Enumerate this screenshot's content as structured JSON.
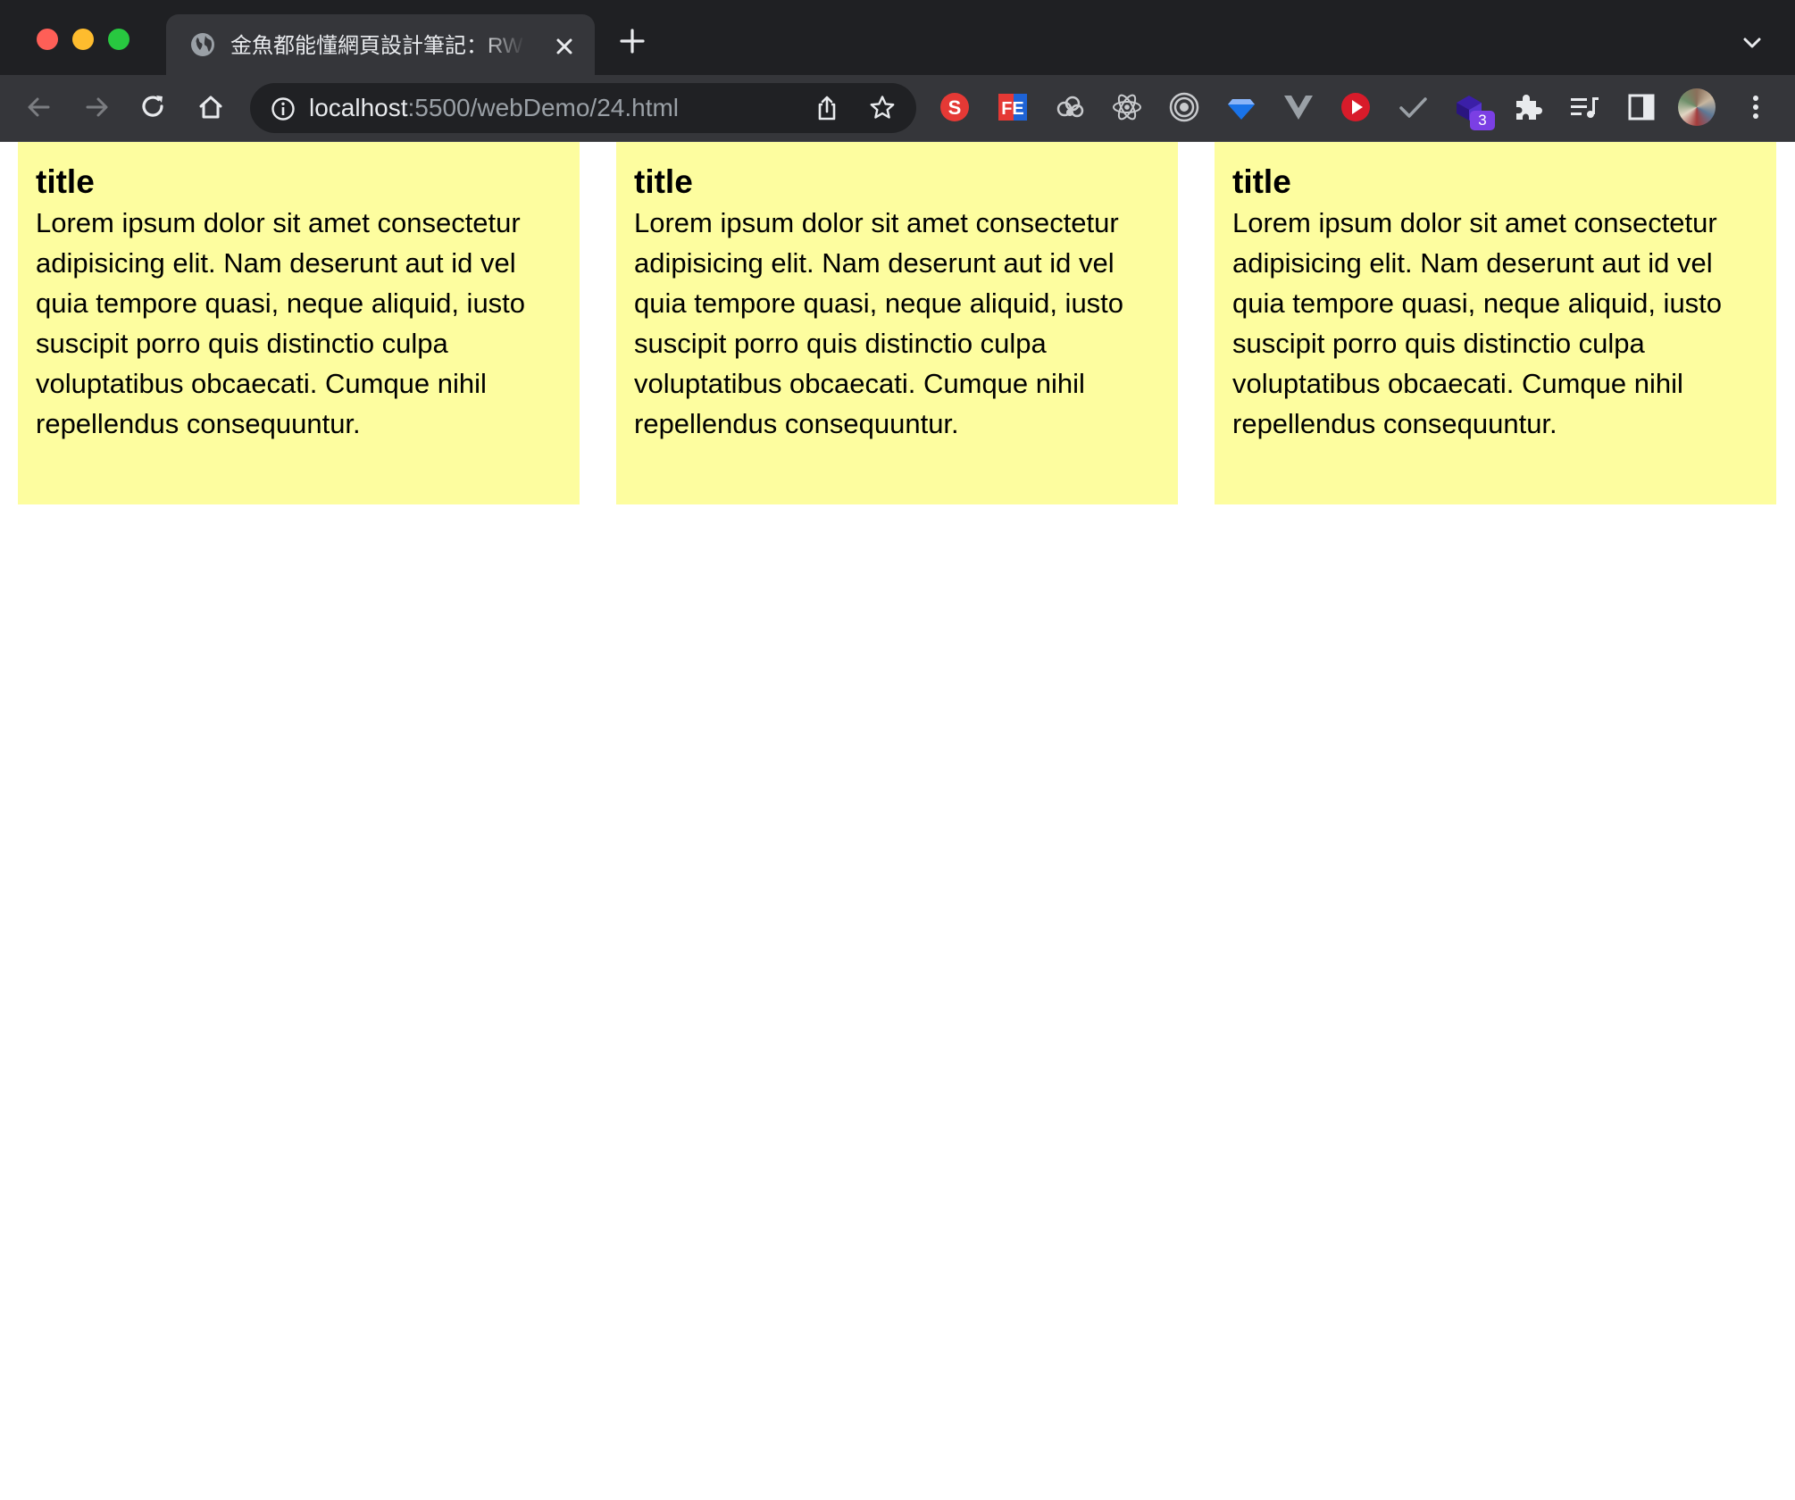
{
  "window": {
    "controls": [
      "close",
      "minimize",
      "zoom"
    ]
  },
  "tab": {
    "title": "金魚都能懂網頁設計筆記：RWD/",
    "favicon": "globe-icon"
  },
  "toolbar": {
    "url_host": "localhost",
    "url_path": ":5500/webDemo/24.html",
    "extension_badge": "3"
  },
  "extensions": [
    "s-extension-icon",
    "fe-helper-icon",
    "cloud-extension-icon",
    "react-devtools-icon",
    "target-extension-icon",
    "gem-extension-icon",
    "vue-devtools-icon",
    "red-play-extension-icon",
    "checkmark-extension-icon",
    "purple-box-extension-icon",
    "puzzle-icon",
    "media-queue-icon",
    "side-panel-icon"
  ],
  "colors": {
    "tabstrip": "#1f2023",
    "toolbar": "#35363a",
    "card_background": "#fdfd9f"
  },
  "cards": [
    {
      "title": "title",
      "body": "Lorem ipsum dolor sit amet consectetur adipisicing elit. Nam deserunt aut id vel quia tempore quasi, neque aliquid, iusto suscipit porro quis distinctio culpa voluptatibus obcaecati. Cumque nihil repellendus consequuntur."
    },
    {
      "title": "title",
      "body": "Lorem ipsum dolor sit amet consectetur adipisicing elit. Nam deserunt aut id vel quia tempore quasi, neque aliquid, iusto suscipit porro quis distinctio culpa voluptatibus obcaecati. Cumque nihil repellendus consequuntur."
    },
    {
      "title": "title",
      "body": "Lorem ipsum dolor sit amet consectetur adipisicing elit. Nam deserunt aut id vel quia tempore quasi, neque aliquid, iusto suscipit porro quis distinctio culpa voluptatibus obcaecati. Cumque nihil repellendus consequuntur."
    }
  ]
}
